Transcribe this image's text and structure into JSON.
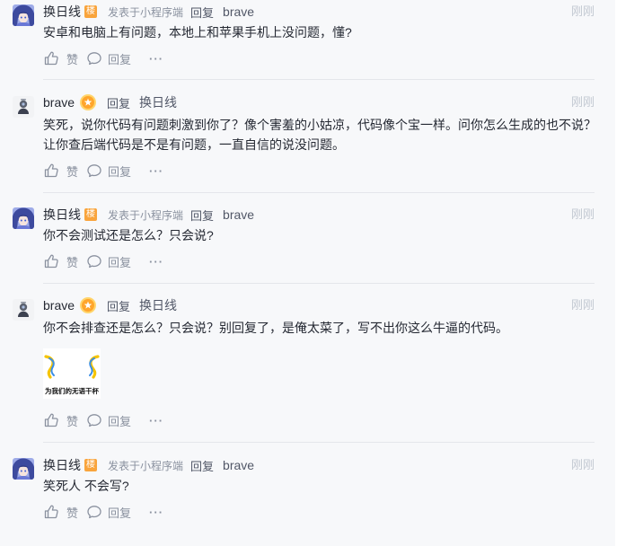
{
  "theme": {
    "panel_background": "#f7f8fa",
    "text_primary": "#252933",
    "text_secondary": "#8a919f",
    "text_reply_target": "#515767",
    "time_color": "#c2c8d1",
    "divider": "#e4e6eb",
    "floor_badge": "#f9a43c",
    "level_badge": "#ffa52b"
  },
  "action_labels": {
    "like": "赞",
    "reply": "回复",
    "more": "···"
  },
  "icons": {
    "like": "thumbs-up-icon",
    "reply": "comment-bubble-icon",
    "more": "ellipsis-icon",
    "level_badge": "gold-star-badge-icon"
  },
  "comments": [
    {
      "author": "换日线",
      "avatar": "anime-avatar",
      "badge": "楼",
      "source": "发表于小程序端",
      "reply_label": "回复",
      "reply_to": "brave",
      "time": "刚刚",
      "content_lines": [
        "安卓和电脑上有问题，本地上和苹果手机上没问题，懂?"
      ]
    },
    {
      "author": "brave",
      "avatar": "brave-avatar",
      "badge_icon": "gold-star-badge-icon",
      "reply_label": "回复",
      "reply_to": "换日线",
      "time": "刚刚",
      "content_lines": [
        "笑死，说你代码有问题刺激到你了？像个害羞的小姑凉，代码像个宝一样。问你怎么生成的也不说？",
        "让你查后端代码是不是有问题，一直自信的说没问题。"
      ]
    },
    {
      "author": "换日线",
      "avatar": "anime-avatar",
      "badge": "楼",
      "source": "发表于小程序端",
      "reply_label": "回复",
      "reply_to": "brave",
      "time": "刚刚",
      "content_lines": [
        "你不会测试还是怎么？只会说?"
      ]
    },
    {
      "author": "brave",
      "avatar": "brave-avatar",
      "badge_icon": "gold-star-badge-icon",
      "reply_label": "回复",
      "reply_to": "换日线",
      "time": "刚刚",
      "content_lines": [
        "你不会排查还是怎么？只会说？别回复了，是俺太菜了，写不出你这么牛逼的代码。"
      ],
      "sticker": {
        "icon": "cheers-sticker",
        "caption": "为我们的无语干杯"
      }
    },
    {
      "author": "换日线",
      "avatar": "anime-avatar",
      "badge": "楼",
      "source": "发表于小程序端",
      "reply_label": "回复",
      "reply_to": "brave",
      "time": "刚刚",
      "content_lines": [
        "笑死人 不会写?"
      ]
    }
  ]
}
